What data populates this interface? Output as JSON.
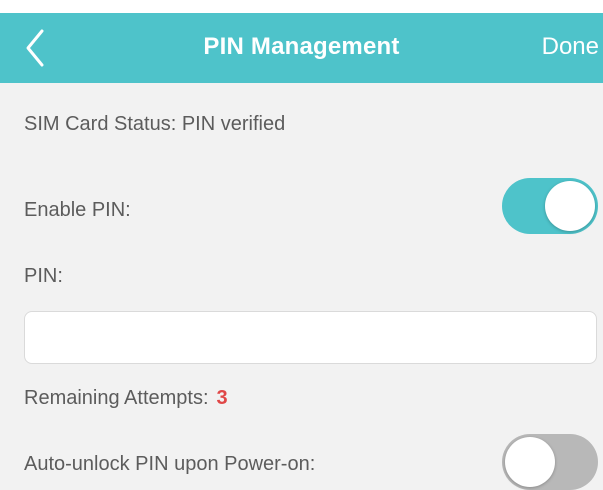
{
  "header": {
    "title": "PIN Management",
    "done_label": "Done",
    "back_icon": "chevron-left-icon"
  },
  "sim": {
    "status_text": "SIM Card Status: PIN verified"
  },
  "enable_pin": {
    "label": "Enable PIN:",
    "value": true
  },
  "pin": {
    "label": "PIN:",
    "value": ""
  },
  "remaining": {
    "label": "Remaining Attempts:",
    "value": "3"
  },
  "auto_unlock": {
    "label": "Auto-unlock PIN upon Power-on:",
    "value": false
  },
  "colors": {
    "accent": "#4ec3ca",
    "background": "#f2f2f2",
    "attempts": "#e04747",
    "toggle_off": "#b8b8b8"
  }
}
